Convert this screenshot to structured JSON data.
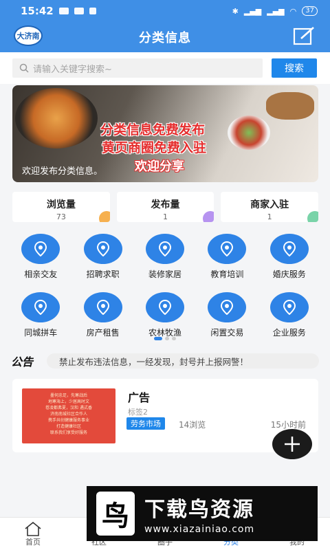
{
  "status": {
    "time": "15:42",
    "battery": "37"
  },
  "header": {
    "logo": "大济南",
    "title": "分类信息"
  },
  "search": {
    "placeholder": "请输入关键字搜索~",
    "button": "搜索"
  },
  "banner": {
    "line1": "分类信息免费发布",
    "line2": "黄页商圈免费入驻",
    "line3": "欢迎分享",
    "caption": "欢迎发布分类信息。"
  },
  "stats": [
    {
      "label": "浏览量",
      "value": "73",
      "color": "#f6b04f"
    },
    {
      "label": "发布量",
      "value": "1",
      "color": "#b693f0"
    },
    {
      "label": "商家入驻",
      "value": "1",
      "color": "#79d3a8"
    }
  ],
  "categories": [
    {
      "label": "相亲交友"
    },
    {
      "label": "招聘求职"
    },
    {
      "label": "装修家居"
    },
    {
      "label": "教育培训"
    },
    {
      "label": "婚庆服务"
    },
    {
      "label": "同城拼车"
    },
    {
      "label": "房产租售"
    },
    {
      "label": "农林牧渔"
    },
    {
      "label": "闲置交易"
    },
    {
      "label": "企业服务"
    }
  ],
  "notice": {
    "tag": "公告",
    "text": "禁止发布违法信息，一经发现，封号并上报网警！"
  },
  "listing": {
    "title": "广告",
    "subtitle": "标签2",
    "tag": "劳务市场",
    "views": "14浏览",
    "time": "15小时前",
    "thumb_lines": [
      "墨何忠足，先寒战后",
      "地寒海上，少居高时文",
      "卷凌都弗夏，汉和 遇式香",
      "济南南城社区合作人",
      "携手共创健康服务事业",
      "打造健康社区",
      "联系我们享受好服务"
    ]
  },
  "tabbar": [
    {
      "label": "首页",
      "icon": "home-icon",
      "active": false
    },
    {
      "label": "社区",
      "icon": "community-icon",
      "active": false
    },
    {
      "label": "圈子",
      "icon": "circle-icon",
      "active": false
    },
    {
      "label": "分类",
      "icon": "category-icon",
      "active": true
    },
    {
      "label": "我的",
      "icon": "profile-icon",
      "active": false
    }
  ],
  "watermark": {
    "logo": "鸟",
    "title": "下载鸟资源",
    "url": "www.xiazainiao.com"
  },
  "colors": {
    "primary": "#3f8fe6",
    "accent": "#1f87ea"
  }
}
